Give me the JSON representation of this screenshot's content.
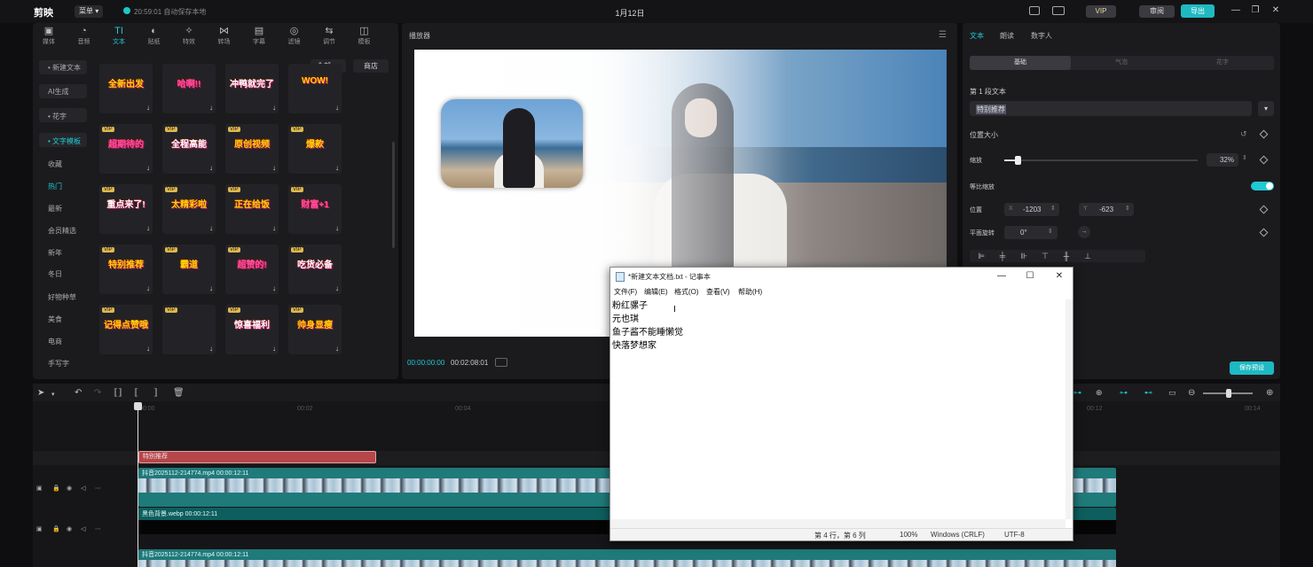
{
  "topbar": {
    "app_name": "剪映",
    "menu_label": "菜单 ▾",
    "autosave": "20:59:01 自动保存本地",
    "project_title": "1月12日",
    "vip_label": "VIP",
    "share_label": "审阅",
    "export_label": "导出"
  },
  "toolbar": {
    "tools": [
      {
        "icon": "media-icon",
        "glyph": "▣",
        "label": "媒体"
      },
      {
        "icon": "audio-icon",
        "glyph": "◔",
        "label": "音频"
      },
      {
        "icon": "text-icon",
        "glyph": "TI",
        "label": "文本"
      },
      {
        "icon": "sticker-icon",
        "glyph": "◐",
        "label": "贴纸"
      },
      {
        "icon": "effects-icon",
        "glyph": "✧",
        "label": "特效"
      },
      {
        "icon": "transition-icon",
        "glyph": "⋈",
        "label": "转场"
      },
      {
        "icon": "subtitle-icon",
        "glyph": "▤",
        "label": "字幕"
      },
      {
        "icon": "filter-icon",
        "glyph": "◎",
        "label": "滤镜"
      },
      {
        "icon": "adjust-icon",
        "glyph": "⇆",
        "label": "调节"
      },
      {
        "icon": "template-icon",
        "glyph": "◫",
        "label": "模板"
      }
    ]
  },
  "categories": {
    "items": [
      "• 新建文本",
      "AI生成",
      "• 花字",
      "• 文字模板",
      "收藏",
      "热门",
      "最新",
      "会员精选",
      "新年",
      "冬日",
      "好物种草",
      "美食",
      "电商",
      "手写字"
    ]
  },
  "filters": {
    "all": "全部 ▼",
    "shop": "商店"
  },
  "templates": {
    "row1": [
      "全新出发",
      "哈啊!!",
      "冲鸭就完了",
      "WOW!"
    ],
    "row2": [
      "超期待的",
      "全程高能",
      "原创视频",
      "爆款"
    ],
    "row3": [
      "重点来了!",
      "太精彩啦",
      "正在给饭",
      "财富+1"
    ],
    "row4": [
      "特别推荐",
      "霸道",
      "超赞的!",
      "吃货必备"
    ],
    "row5": [
      "记得点赞哦",
      "",
      "惊喜福利",
      "帅身显瘦"
    ],
    "vip_tag": "VIP",
    "download_glyph": "↓"
  },
  "player": {
    "title": "播放器",
    "time_current": "00:00:00:00",
    "time_total": "00:02:08:01"
  },
  "props": {
    "tabs": [
      "文本",
      "朗读",
      "数字人"
    ],
    "segments": [
      "基础",
      "气泡",
      "花字"
    ],
    "section_text": "第 1 段文本",
    "text_value": "特别推荐",
    "section_position": "位置大小",
    "scale_label": "缩放",
    "scale_value": "32%",
    "scale_level": 0.32,
    "uniform_label": "等比缩放",
    "uniform_on": true,
    "pos_label": "位置",
    "x_label": "X",
    "x_value": "-1203",
    "y_label": "Y",
    "y_value": "-623",
    "rotate_label": "平面旋转",
    "rotate_value": "0°",
    "preset_button": "保存预设"
  },
  "timeline": {
    "ticks": [
      "00:00",
      "00:02",
      "00:04",
      "00:12",
      "00:14"
    ],
    "text_clip": "特别推荐",
    "video1_label": "抖音2025112-214774.mp4  00:00:12:11",
    "bg_label": "黑色背景.webp  00:00:12:11",
    "video2_label": "抖音2025112-214774.mp4  00:00:12:11"
  },
  "notepad": {
    "title": "*新建文本文档.txt - 记事本",
    "menus": [
      "文件(F)",
      "编辑(E)",
      "格式(O)",
      "查看(V)",
      "帮助(H)"
    ],
    "lines": [
      "粉红骡子",
      "元也琪",
      "鱼子酱不能睡懒觉",
      "快落梦想家"
    ],
    "status_pos": "第 4 行，第 6 列",
    "status_zoom": "100%",
    "status_eol": "Windows (CRLF)",
    "status_enc": "UTF-8"
  },
  "colors": {
    "accent": "#20c9d4",
    "text_clip": "#b5464a",
    "video_clip": "#1f7a7a"
  }
}
